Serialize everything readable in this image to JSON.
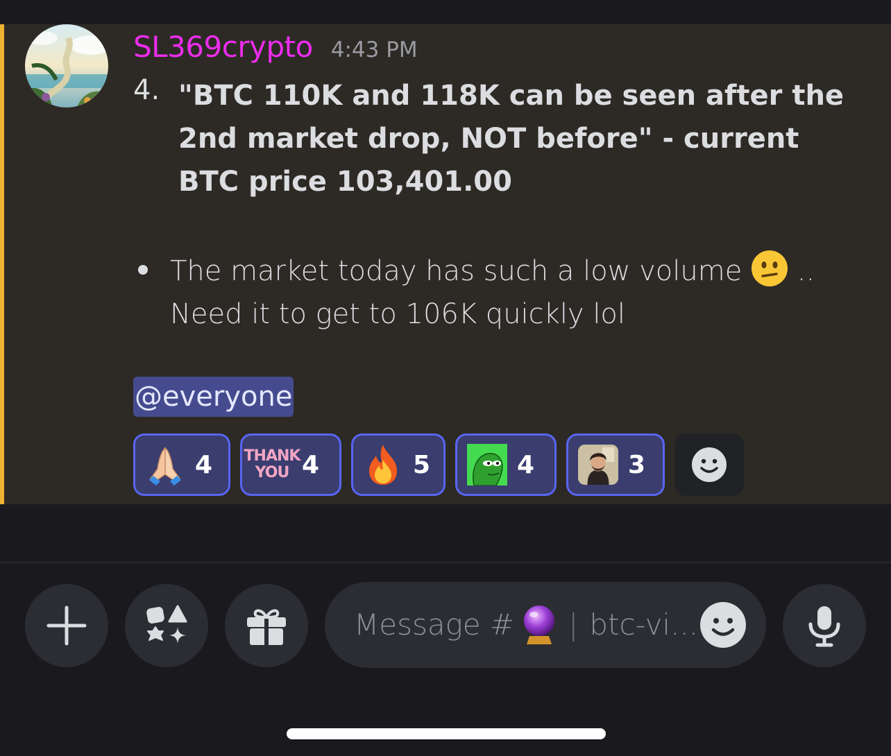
{
  "message": {
    "username": "SL369crypto",
    "timestamp": "4:43 PM",
    "list_number": "4.",
    "list_text": "\"BTC 110K and 118K can be seen after the 2nd market drop, NOT before\" - current BTC price 103,401.00",
    "bullet_text_1": "The market today has such a low volume",
    "bullet_text_2": "..",
    "bullet_text_3": "Need it to get to 106K quickly lol",
    "mention": "@everyone",
    "accent_color": "#f0b232",
    "username_color": "#ec2ded"
  },
  "reactions": [
    {
      "icon": "folded-hands-icon",
      "count": "4"
    },
    {
      "icon": "thank-you-sticker-icon",
      "label_line1": "THANK",
      "label_line2": "YOU",
      "count": "4"
    },
    {
      "icon": "fire-icon",
      "count": "5"
    },
    {
      "icon": "green-frog-icon",
      "count": "4"
    },
    {
      "icon": "man-portrait-icon",
      "count": "3"
    }
  ],
  "composer": {
    "placeholder_prefix": "Message #",
    "placeholder_channel": "btc-vi...",
    "buttons": [
      "plus-icon",
      "apps-icon",
      "gift-icon",
      "microphone-icon"
    ]
  }
}
